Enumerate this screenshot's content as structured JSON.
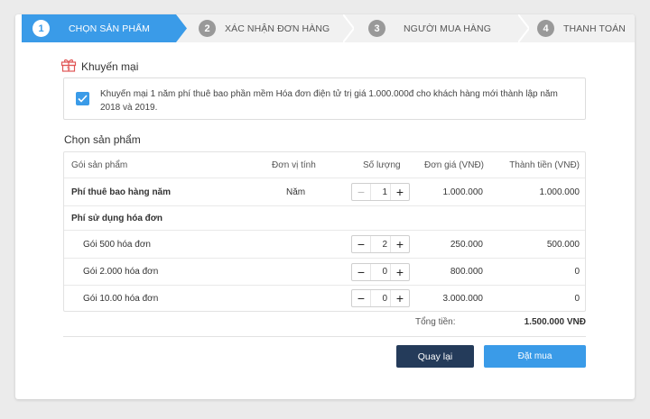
{
  "stepper": [
    {
      "num": "1",
      "label": "CHỌN SẢN PHẨM"
    },
    {
      "num": "2",
      "label": "XÁC NHẬN ĐƠN HÀNG"
    },
    {
      "num": "3",
      "label": "NGƯỜI MUA HÀNG"
    },
    {
      "num": "4",
      "label": "THANH TOÁN"
    }
  ],
  "promo": {
    "title": "Khuyến mại",
    "text": "Khuyến mại 1 năm phí thuê bao phần mềm Hóa đơn điện tử trị giá 1.000.000đ cho khách hàng mới thành lập năm 2018 và 2019."
  },
  "section_title": "Chọn sản phẩm",
  "table": {
    "headers": [
      "Gói sản phẩm",
      "Đơn vị tính",
      "Số lượng",
      "Đơn giá (VNĐ)",
      "Thành tiền (VNĐ)"
    ],
    "rows": [
      {
        "name": "Phí thuê bao hàng năm",
        "unit": "Năm",
        "qty": "1",
        "price": "1.000.000",
        "total": "1.000.000"
      },
      {
        "name": "Phí sử dụng hóa đơn"
      },
      {
        "name": "Gói 500 hóa đơn",
        "qty": "2",
        "price": "250.000",
        "total": "500.000"
      },
      {
        "name": "Gói 2.000 hóa đơn",
        "qty": "0",
        "price": "800.000",
        "total": "0"
      },
      {
        "name": "Gói 10.00 hóa đơn",
        "qty": "0",
        "price": "3.000.000",
        "total": "0"
      }
    ]
  },
  "total": {
    "label": "Tổng tiền:",
    "value": "1.500.000 VNĐ"
  },
  "buttons": {
    "back": "Quay lại",
    "buy": "Đặt mua"
  },
  "icons": {
    "minus": "−",
    "plus": "+"
  }
}
